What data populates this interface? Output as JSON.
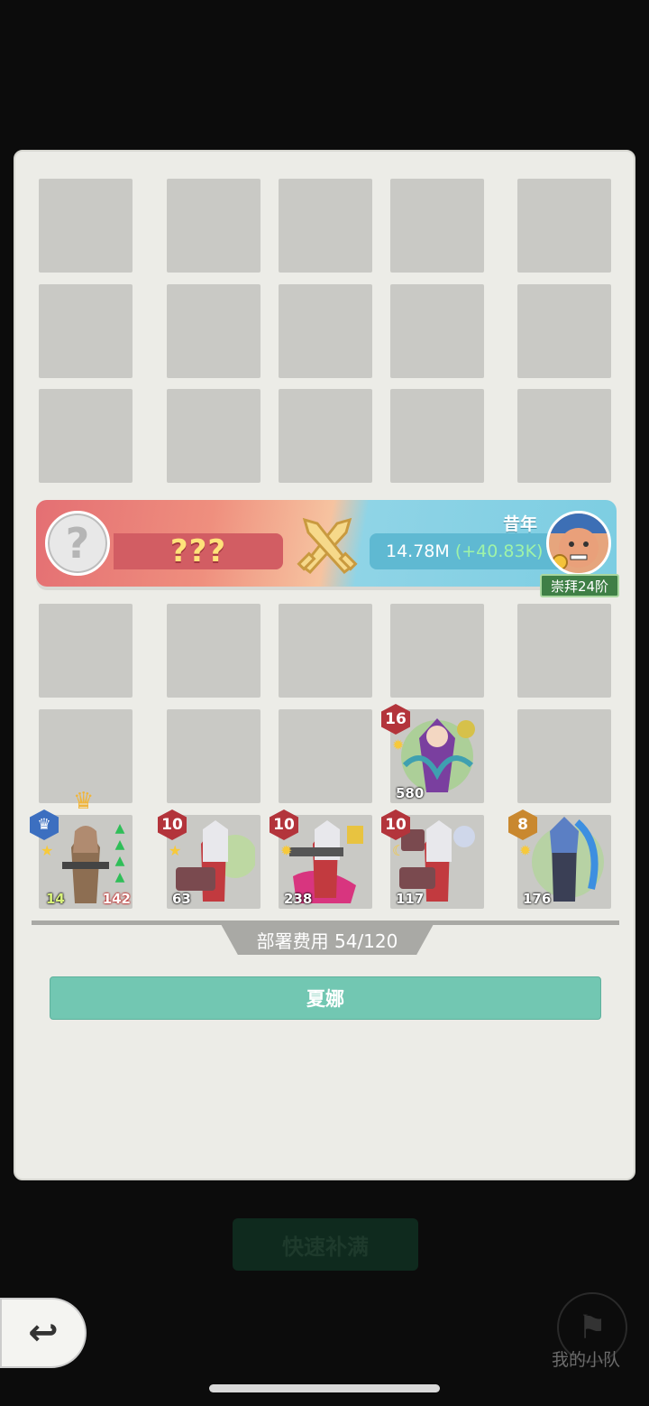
{
  "banner": {
    "left_value": "???",
    "right_name": "昔年",
    "right_power": "14.78M",
    "right_gain": "(+40.83K)",
    "rank": "崇拜24阶"
  },
  "units": [
    {
      "level": "16",
      "level_color": "#b3343b",
      "power": "580"
    },
    {
      "level": "",
      "level_color": "#3c6fc0",
      "power_left": "14",
      "power_right": "142"
    },
    {
      "level": "10",
      "level_color": "#b3343b",
      "power": "63"
    },
    {
      "level": "10",
      "level_color": "#b3343b",
      "power": "238"
    },
    {
      "level": "10",
      "level_color": "#b3343b",
      "power": "117"
    },
    {
      "level": "8",
      "level_color": "#c9882f",
      "power": "176"
    }
  ],
  "deploy_cost": "部署费用 54/120",
  "team_name": "夏娜",
  "background": {
    "quick_button": "快速补满",
    "my_team": "我的小队"
  },
  "icons": {
    "back": "back-arrow-icon",
    "unknown": "question-mark-icon",
    "versus": "crossed-swords-icon",
    "crown": "crown-icon",
    "flag": "flag-icon"
  },
  "colors": {
    "panel": "#ecece7",
    "slot": "#c9c9c5",
    "team_bar": "#72c7b2",
    "banner_left": "#e46f73",
    "banner_right": "#7ccde2"
  }
}
